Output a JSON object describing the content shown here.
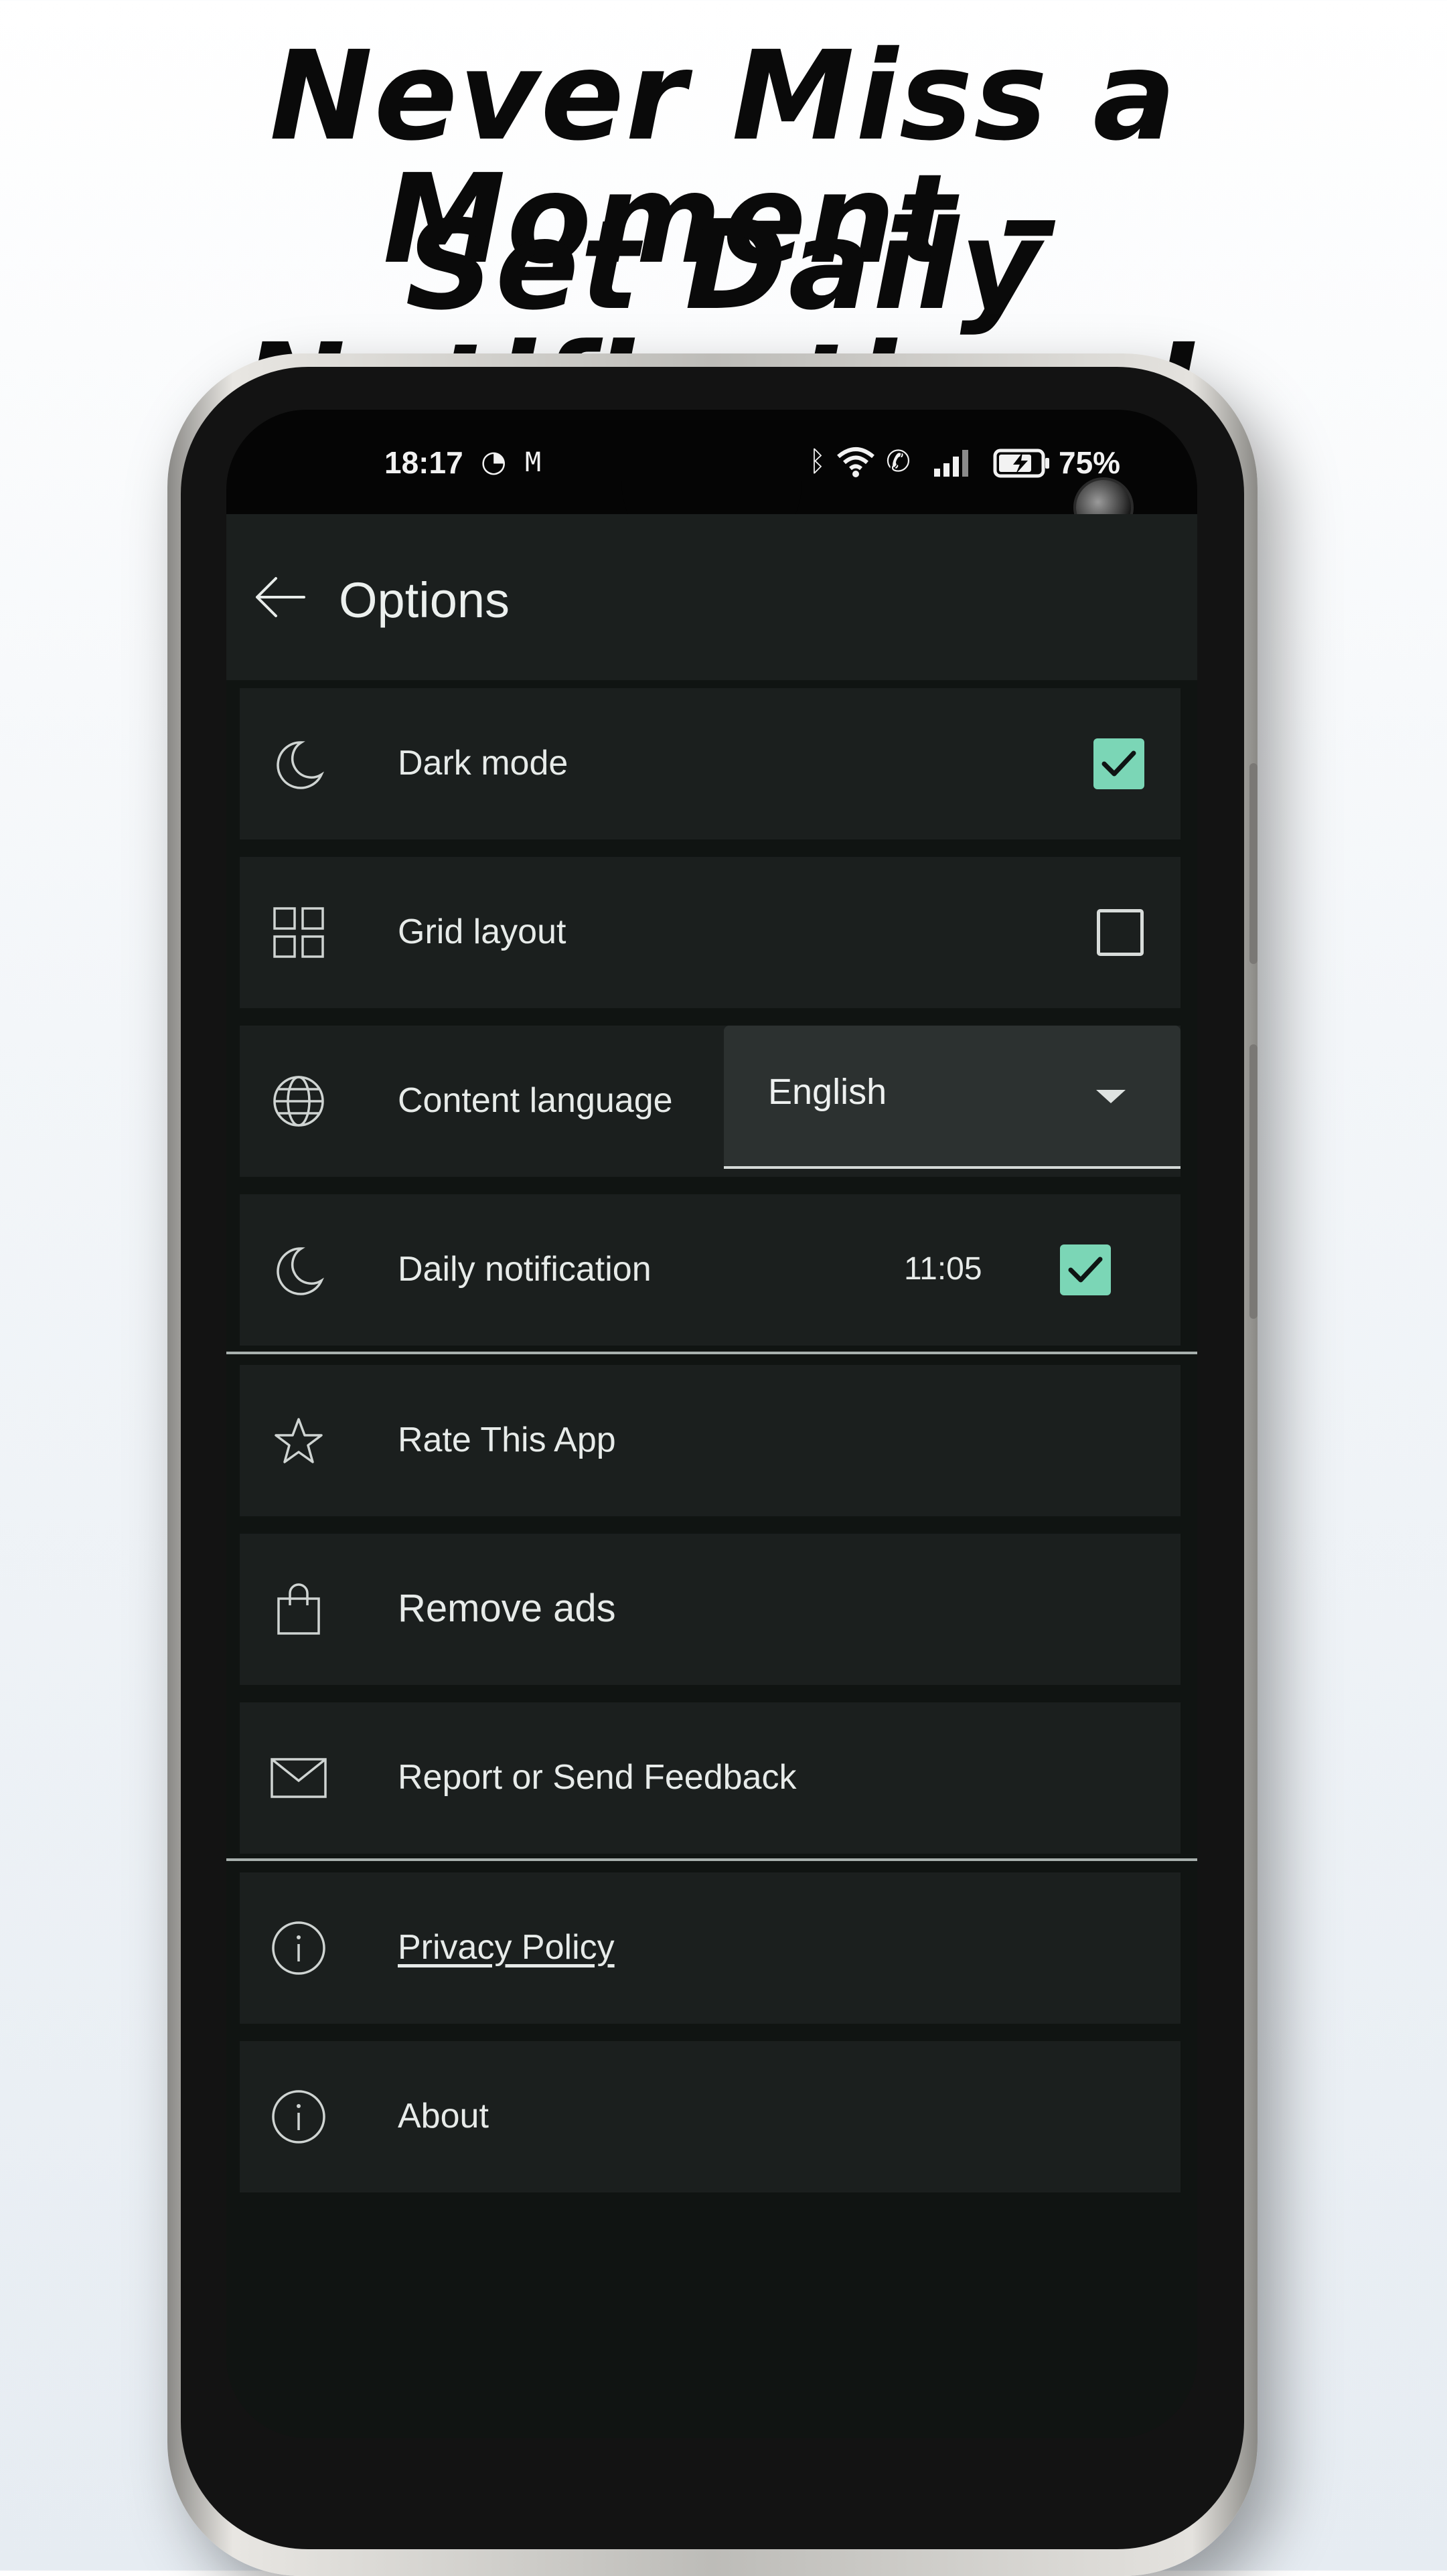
{
  "headline": {
    "line1": "Never Miss a Moment –",
    "line2": "Set Daily Notifications!"
  },
  "status_bar": {
    "time": "18:17",
    "left_icons": [
      "messenger-icon",
      "gmail-icon"
    ],
    "right_icons": [
      "bluetooth-icon",
      "wifi-icon",
      "wifi-call-icon",
      "signal-icon",
      "battery-charging-icon"
    ],
    "battery": "75%"
  },
  "appbar": {
    "title": "Options"
  },
  "settings": {
    "dark_mode": {
      "label": "Dark mode",
      "checked": true
    },
    "grid_layout": {
      "label": "Grid layout",
      "checked": false
    },
    "content_language": {
      "label": "Content language",
      "selected": "English"
    },
    "daily_notification": {
      "label": "Daily notification",
      "time": "11:05",
      "checked": true
    }
  },
  "actions": {
    "rate": "Rate This App",
    "remove_ads": "Remove ads",
    "feedback": "Report or Send Feedback",
    "privacy": "Privacy Policy",
    "about": "About"
  },
  "colors": {
    "accent": "#7bd6b6",
    "row_bg": "#1b1f1e",
    "screen_bg": "#101412",
    "text": "#e7ebe9"
  }
}
